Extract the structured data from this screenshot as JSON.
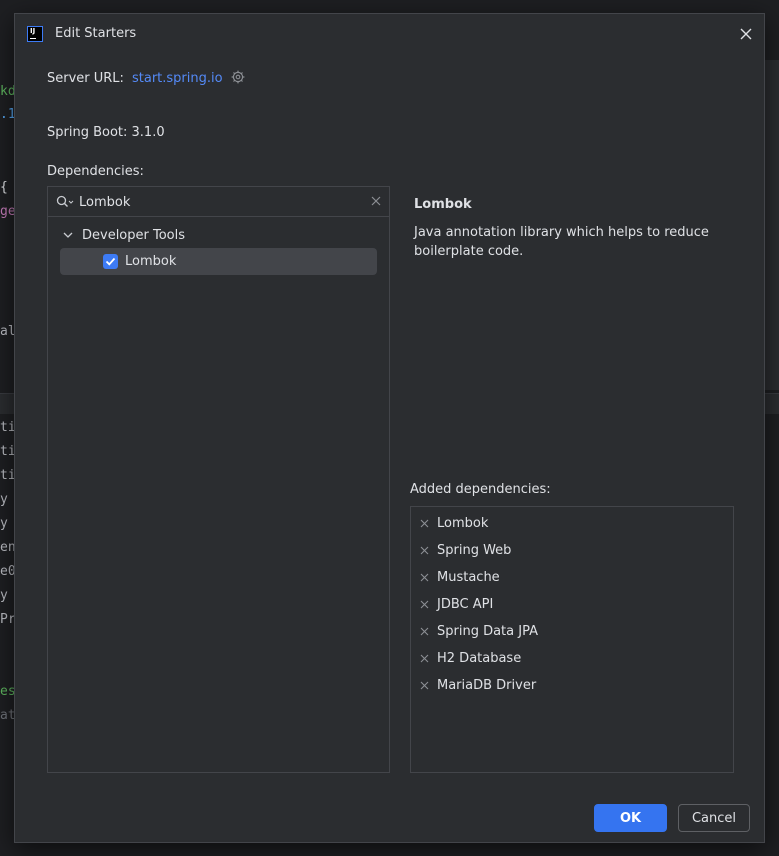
{
  "background_editor": {
    "fragments": [
      {
        "text": "kd",
        "color": "#5fb860"
      },
      {
        "text": ".1",
        "color": "#56a8f5"
      },
      {
        "text": "{",
        "color": "#dfe1e5"
      },
      {
        "text": "ge",
        "color": "#c77dbb"
      },
      {
        "text": "al",
        "color": "#bcbec4"
      },
      {
        "text": "ti",
        "color": "#bcbec4"
      },
      {
        "text": "ti",
        "color": "#bcbec4"
      },
      {
        "text": "ti",
        "color": "#bcbec4"
      },
      {
        "text": "y",
        "color": "#bcbec4"
      },
      {
        "text": "y",
        "color": "#bcbec4"
      },
      {
        "text": "en",
        "color": "#bcbec4"
      },
      {
        "text": "e0",
        "color": "#bcbec4"
      },
      {
        "text": "y",
        "color": "#bcbec4"
      },
      {
        "text": "Pr",
        "color": "#bcbec4"
      },
      {
        "text": "es",
        "color": "#5fb860"
      },
      {
        "text": "at",
        "color": "#6f737a"
      }
    ]
  },
  "dialog": {
    "title": "Edit Starters",
    "server_url_label": "Server URL:",
    "server_url_value": "start.spring.io",
    "spring_boot_label": "Spring Boot: 3.1.0",
    "dependencies_label": "Dependencies:",
    "search": {
      "value": "Lombok",
      "placeholder": ""
    },
    "tree": {
      "group_label": "Developer Tools",
      "item_label": "Lombok",
      "item_checked": true
    },
    "description": {
      "title": "Lombok",
      "text": "Java annotation library which helps to reduce boilerplate code."
    },
    "added_label": "Added dependencies:",
    "added_dependencies": [
      "Lombok",
      "Spring Web",
      "Mustache",
      "JDBC API",
      "Spring Data JPA",
      "H2 Database",
      "MariaDB Driver"
    ],
    "ok_label": "OK",
    "cancel_label": "Cancel"
  },
  "colors": {
    "accent": "#3574f0",
    "link": "#548af7",
    "dialog_bg": "#2b2d30",
    "selection_bg": "#43454a"
  }
}
